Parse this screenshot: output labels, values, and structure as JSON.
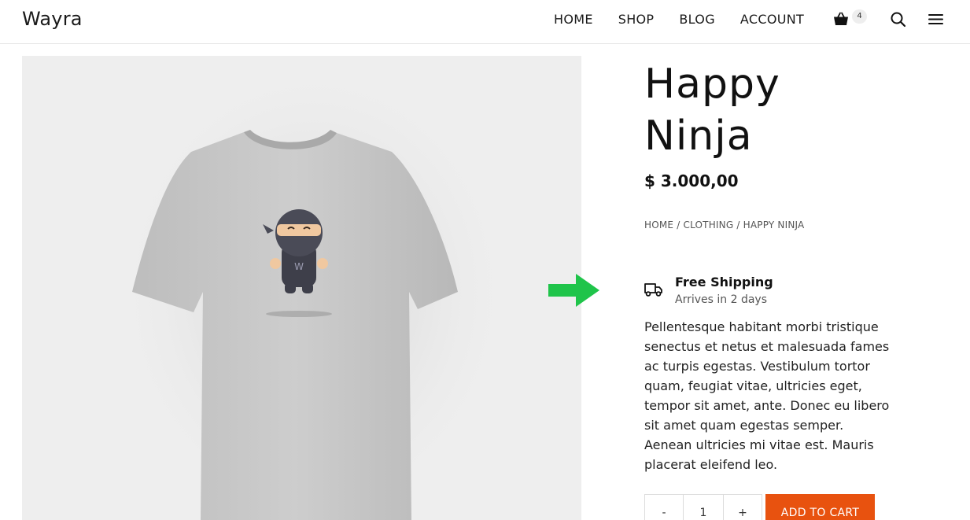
{
  "header": {
    "logo": "Wayra",
    "nav": [
      "HOME",
      "SHOP",
      "BLOG",
      "ACCOUNT"
    ],
    "cart_count": "4",
    "icons": [
      "shopping-basket-icon",
      "search-icon",
      "menu-icon"
    ]
  },
  "product": {
    "title_line1": "Happy",
    "title_line2": "Ninja",
    "price": "$ 3.000,00",
    "breadcrumb": [
      "HOME",
      "CLOTHING",
      "HAPPY NINJA"
    ],
    "breadcrumb_sep": "/",
    "image_shirt_logo": "W",
    "shipping_title": "Free Shipping",
    "shipping_subtitle": "Arrives in 2 days",
    "description": "Pellentesque habitant morbi tristique senectus et netus et malesuada fames ac turpis egestas. Vestibulum tortor quam, feugiat vitae, ultricies eget, tempor sit amet, ante. Donec eu libero sit amet quam egestas semper. Aenean ultricies mi vitae est. Mauris placerat eleifend leo.",
    "quantity": "1",
    "decrease_label": "-",
    "increase_label": "+",
    "add_to_cart_label": "ADD TO CART"
  },
  "colors": {
    "accent": "#e8520f",
    "arrow": "#1fc44a",
    "gallery_bg": "#eeeeee"
  }
}
